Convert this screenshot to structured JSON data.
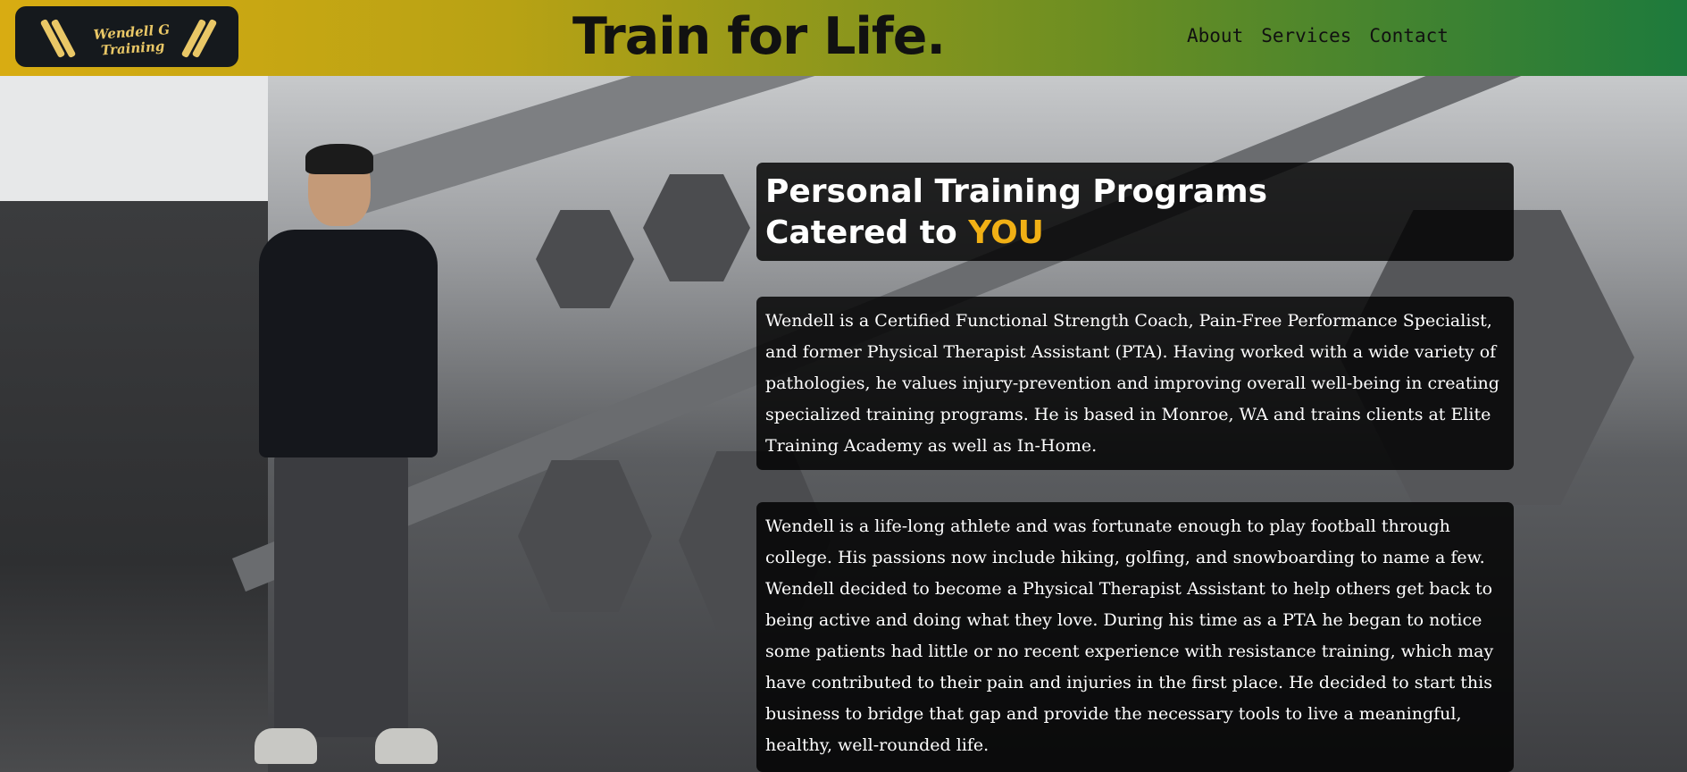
{
  "header": {
    "logo_text": "Wendell G Training",
    "title": "Train for Life.",
    "nav": [
      "About",
      "Services",
      "Contact"
    ]
  },
  "hero": {
    "headline_part1": "Personal Training Programs Catered to ",
    "headline_accent": "YOU",
    "paragraphs": [
      "Wendell is a Certified Functional Strength Coach, Pain-Free Performance Specialist, and former Physical Therapist Assistant (PTA). Having worked with a wide variety of pathologies, he values injury-prevention and improving overall well-being in creating specialized training programs. He is based in Monroe, WA and trains clients at Elite Training Academy as well as In-Home.",
      "Wendell is a life-long athlete and was fortunate enough to play football through college. His passions now include hiking, golfing, and snowboarding to name a few. Wendell decided to become a Physical Therapist Assistant to help others get back to being active and doing what they love. During his time as a PTA he began to notice some patients had little or no recent experience with resistance training, which may have contributed to their pain and injuries in the first place. He decided to start this business to bridge that gap and provide the necessary tools to live a meaningful, healthy, well-rounded life."
    ]
  },
  "colors": {
    "accent": "#f1b015",
    "header_gradient_start": "#d8ac12",
    "header_gradient_end": "#1d7a3c"
  }
}
